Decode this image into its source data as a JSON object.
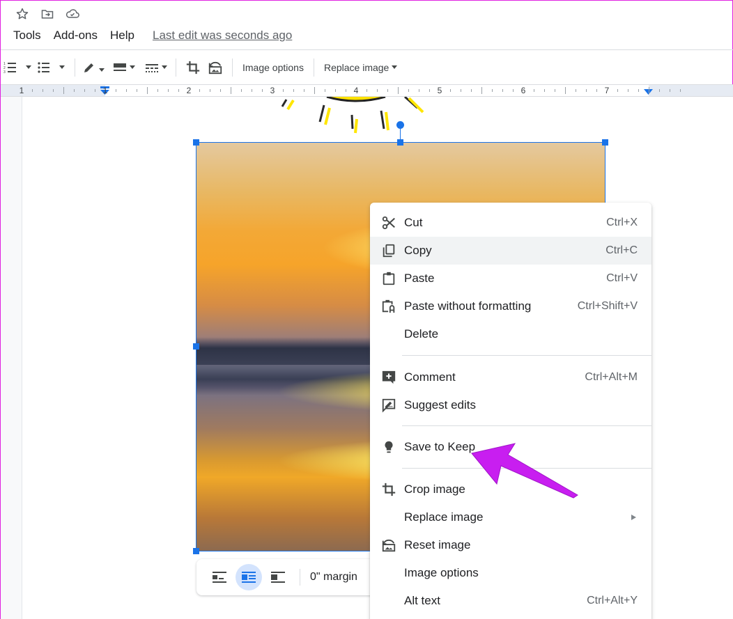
{
  "top_icons": [
    "star-icon",
    "move-to-folder-icon",
    "cloud-saved-icon"
  ],
  "menubar": {
    "items": [
      "Tools",
      "Add-ons",
      "Help"
    ],
    "last_edit": "Last edit was seconds ago"
  },
  "toolbar": {
    "image_options": "Image options",
    "replace_image": "Replace image"
  },
  "ruler": {
    "labels": [
      "1",
      "1",
      "2",
      "3",
      "4",
      "5",
      "6",
      "7"
    ]
  },
  "image_toolbar": {
    "margin": "0\" margin",
    "wrap_modes": [
      "inline",
      "wrap-text",
      "break-text"
    ],
    "active_mode": "wrap-text"
  },
  "context_menu": {
    "items": [
      {
        "label": "Cut",
        "shortcut": "Ctrl+X",
        "icon": "scissors-icon"
      },
      {
        "label": "Copy",
        "shortcut": "Ctrl+C",
        "icon": "copy-icon",
        "highlighted": true
      },
      {
        "label": "Paste",
        "shortcut": "Ctrl+V",
        "icon": "clipboard-icon"
      },
      {
        "label": "Paste without formatting",
        "shortcut": "Ctrl+Shift+V",
        "icon": "paste-plain-icon"
      },
      {
        "label": "Delete",
        "shortcut": ""
      },
      {
        "label": "Comment",
        "shortcut": "Ctrl+Alt+M",
        "icon": "add-comment-icon"
      },
      {
        "label": "Suggest edits",
        "shortcut": "",
        "icon": "suggest-edits-icon"
      },
      {
        "label": "Save to Keep",
        "shortcut": "",
        "icon": "lightbulb-icon"
      },
      {
        "label": "Crop image",
        "shortcut": "",
        "icon": "crop-icon"
      },
      {
        "label": "Replace image",
        "shortcut": "",
        "submenu": true
      },
      {
        "label": "Reset image",
        "shortcut": "",
        "icon": "reset-image-icon"
      },
      {
        "label": "Image options",
        "shortcut": ""
      },
      {
        "label": "Alt text",
        "shortcut": "Ctrl+Alt+Y"
      }
    ]
  },
  "colors": {
    "accent": "#1a73e8",
    "annotation_arrow": "#c81ef0",
    "menu_highlight": "#f1f3f4"
  }
}
